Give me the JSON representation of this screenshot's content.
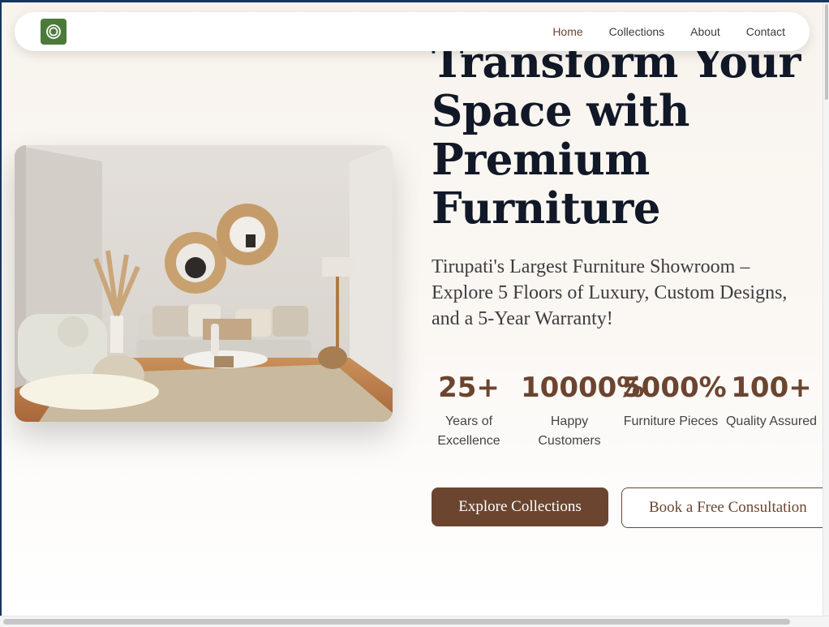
{
  "nav": {
    "logo_icon": "circle-target-icon",
    "links": [
      {
        "label": "Home",
        "active": true
      },
      {
        "label": "Collections",
        "active": false
      },
      {
        "label": "About",
        "active": false
      },
      {
        "label": "Contact",
        "active": false
      }
    ]
  },
  "hero": {
    "headline": "Transform Your Space with Premium Furniture",
    "subtitle": "Tirupati's Largest Furniture Showroom – Explore 5 Floors of Luxury, Custom Designs, and a 5-Year Warranty!",
    "image_subject": "living-room-photo"
  },
  "stats": [
    {
      "number": "25+",
      "label": "Years of Excellence"
    },
    {
      "number": "10000%",
      "label": "Happy Customers"
    },
    {
      "number": "5000%",
      "label": "Furniture Pieces"
    },
    {
      "number": "100+",
      "label": "Quality Assured"
    }
  ],
  "buttons": {
    "primary": "Explore Collections",
    "secondary": "Book a Free Consultation"
  },
  "colors": {
    "brand_brown": "#6b4530",
    "logo_green": "#4b7a3a",
    "headline": "#111827"
  }
}
